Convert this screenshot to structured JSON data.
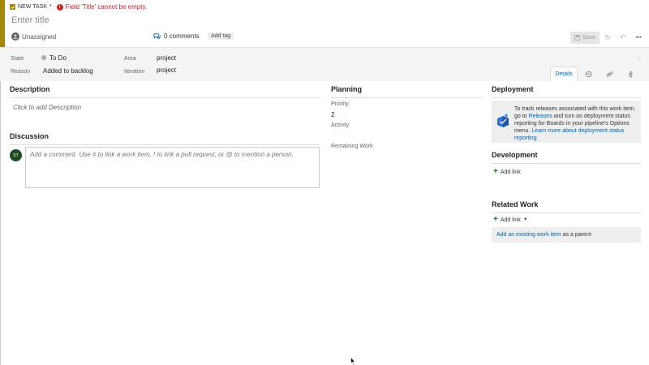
{
  "header": {
    "task_type": "NEW TASK",
    "dirty_marker": "*",
    "error_message": "Field 'Title' cannot be empty.",
    "title_placeholder": "Enter title",
    "assigned_to": "Unassigned",
    "comments_count": "0 comments",
    "add_tag_label": "Add tag",
    "save_label": "Save"
  },
  "fields": {
    "state_label": "State",
    "state_value": "To Do",
    "reason_label": "Reason",
    "reason_value": "Added to backlog",
    "area_label": "Area",
    "area_value": "project",
    "iteration_label": "Iteration",
    "iteration_value": "project"
  },
  "tabs": {
    "details_label": "Details"
  },
  "description": {
    "heading": "Description",
    "placeholder": "Click to add Description"
  },
  "discussion": {
    "heading": "Discussion",
    "avatar_initials": "ST",
    "comment_placeholder": "Add a comment. Use # to link a work item, ! to link a pull request, or @ to mention a person."
  },
  "planning": {
    "heading": "Planning",
    "priority_label": "Priority",
    "priority_value": "2",
    "activity_label": "Activity",
    "remaining_work_label": "Remaining Work"
  },
  "deployment": {
    "heading": "Deployment",
    "text_1": "To track releases associated with this work item, go to ",
    "releases_link": "Releases",
    "text_2": " and turn on deployment status reporting for Boards in your pipeline's Options menu. ",
    "learn_more_link": "Learn more about deployment status reporting"
  },
  "development": {
    "heading": "Development",
    "add_link_label": "Add link"
  },
  "related_work": {
    "heading": "Related Work",
    "add_link_label": "Add link",
    "existing_link": "Add an existing work item",
    "existing_suffix": " as a parent"
  },
  "colors": {
    "accent": "#a4880a",
    "error": "#c62828",
    "link": "#0063b1",
    "avatar": "#1f4b22"
  }
}
